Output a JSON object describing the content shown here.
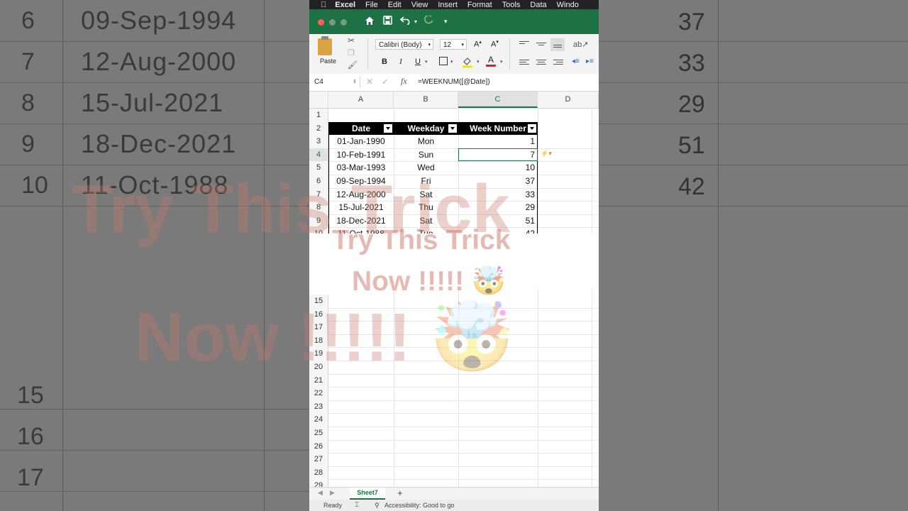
{
  "background": {
    "left_rows": [
      {
        "row": "6",
        "date": "09-Sep-1994"
      },
      {
        "row": "7",
        "date": "12-Aug-2000"
      },
      {
        "row": "8",
        "date": "15-Jul-2021"
      },
      {
        "row": "9",
        "date": "18-Dec-2021"
      },
      {
        "row": "10",
        "date": "11-Oct-1988"
      }
    ],
    "left_lower_rows": [
      "15",
      "16",
      "17"
    ],
    "right_values": [
      "37",
      "33",
      "29",
      "51",
      "42"
    ]
  },
  "menubar": {
    "app": "Excel",
    "items": [
      "File",
      "Edit",
      "View",
      "Insert",
      "Format",
      "Tools",
      "Data",
      "Windo"
    ]
  },
  "ribbon": {
    "paste_label": "Paste",
    "font_name": "Calibri (Body)",
    "font_size": "12",
    "bold": "B",
    "italic": "I",
    "underline": "U"
  },
  "formula_bar": {
    "name_box": "C4",
    "formula": "=WEEKNUM([@Date])"
  },
  "columns": [
    "A",
    "B",
    "C",
    "D"
  ],
  "table": {
    "headers": [
      "Date",
      "Weekday",
      "Week Number"
    ],
    "rows": [
      {
        "row": "3",
        "date": "01-Jan-1990",
        "weekday": "Mon",
        "week": "1"
      },
      {
        "row": "4",
        "date": "10-Feb-1991",
        "weekday": "Sun",
        "week": "7"
      },
      {
        "row": "5",
        "date": "03-Mar-1993",
        "weekday": "Wed",
        "week": "10"
      },
      {
        "row": "6",
        "date": "09-Sep-1994",
        "weekday": "Fri",
        "week": "37"
      },
      {
        "row": "7",
        "date": "12-Aug-2000",
        "weekday": "Sat",
        "week": "33"
      },
      {
        "row": "8",
        "date": "15-Jul-2021",
        "weekday": "Thu",
        "week": "29"
      },
      {
        "row": "9",
        "date": "18-Dec-2021",
        "weekday": "Sat",
        "week": "51"
      },
      {
        "row": "10",
        "date": "11-Oct-1988",
        "weekday": "Tue",
        "week": "42"
      }
    ]
  },
  "row_labels_top": [
    "1",
    "2"
  ],
  "row_labels_bottom": [
    "15",
    "16",
    "17",
    "18",
    "19",
    "20",
    "21",
    "22",
    "23",
    "24",
    "25",
    "26",
    "27",
    "28",
    "29"
  ],
  "overlay": {
    "line1": "Try This Trick",
    "line2": "Now !!!!! 🤯"
  },
  "sheet_tab": "Sheet7",
  "add_sheet": "+",
  "status": {
    "ready": "Ready",
    "accessibility": "Accessibility: Good to go"
  },
  "colors": {
    "excel_green": "#1e7145",
    "header_fill": "#000000"
  }
}
